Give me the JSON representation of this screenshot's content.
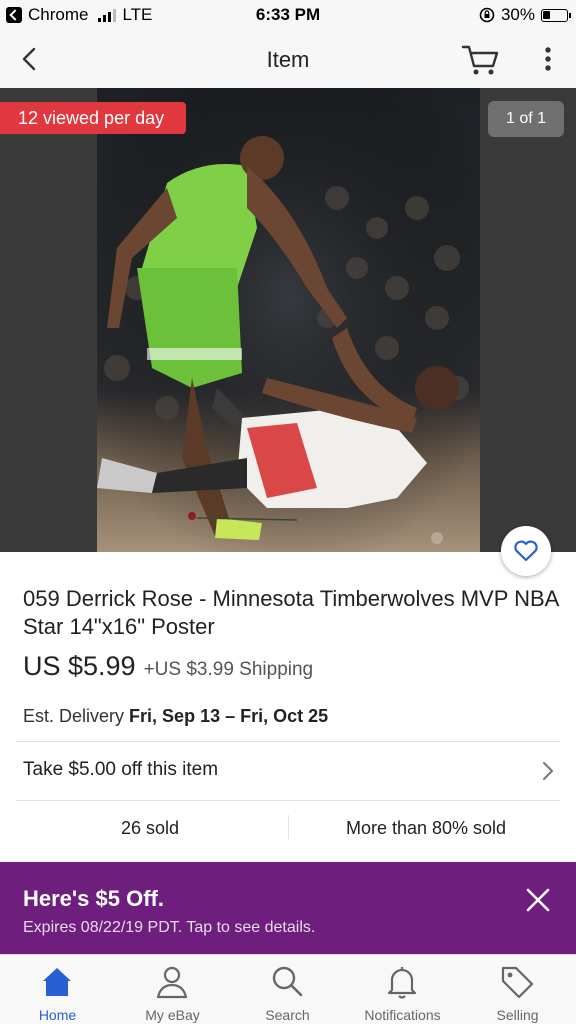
{
  "status_bar": {
    "back_app": "Chrome",
    "network": "LTE",
    "time": "6:33 PM",
    "battery": "30%"
  },
  "header": {
    "title": "Item",
    "back_icon": "chevron-left-icon",
    "cart_icon": "cart-icon",
    "more_icon": "more-vertical-icon"
  },
  "gallery": {
    "views_badge": "12 viewed per day",
    "image_counter": "1 of 1"
  },
  "item": {
    "title": "059 Derrick Rose - Minnesota Timberwolves MVP NBA Star 14\"x16\" Poster",
    "price": "US $5.99",
    "shipping": "+US $3.99 Shipping",
    "delivery_label": "Est. Delivery",
    "delivery_dates": "Fri, Sep 13 – Fri, Oct 25",
    "offer_label": "Take $5.00 off this item",
    "sold_count": "26 sold",
    "sold_percent": "More than 80% sold"
  },
  "promo": {
    "title": "Here's $5 Off.",
    "subtitle": "Expires 08/22/19 PDT. Tap to see details.",
    "background": "#6e1f7e"
  },
  "tabbar": {
    "items": [
      {
        "label": "Home",
        "icon": "home-icon",
        "active": true
      },
      {
        "label": "My eBay",
        "icon": "person-icon",
        "active": false
      },
      {
        "label": "Search",
        "icon": "search-icon",
        "active": false
      },
      {
        "label": "Notifications",
        "icon": "bell-icon",
        "active": false
      },
      {
        "label": "Selling",
        "icon": "tag-icon",
        "active": false
      }
    ]
  },
  "colors": {
    "accent_blue": "#2860d3",
    "badge_red": "#e0383e",
    "promo_purple": "#6e1f7e"
  }
}
